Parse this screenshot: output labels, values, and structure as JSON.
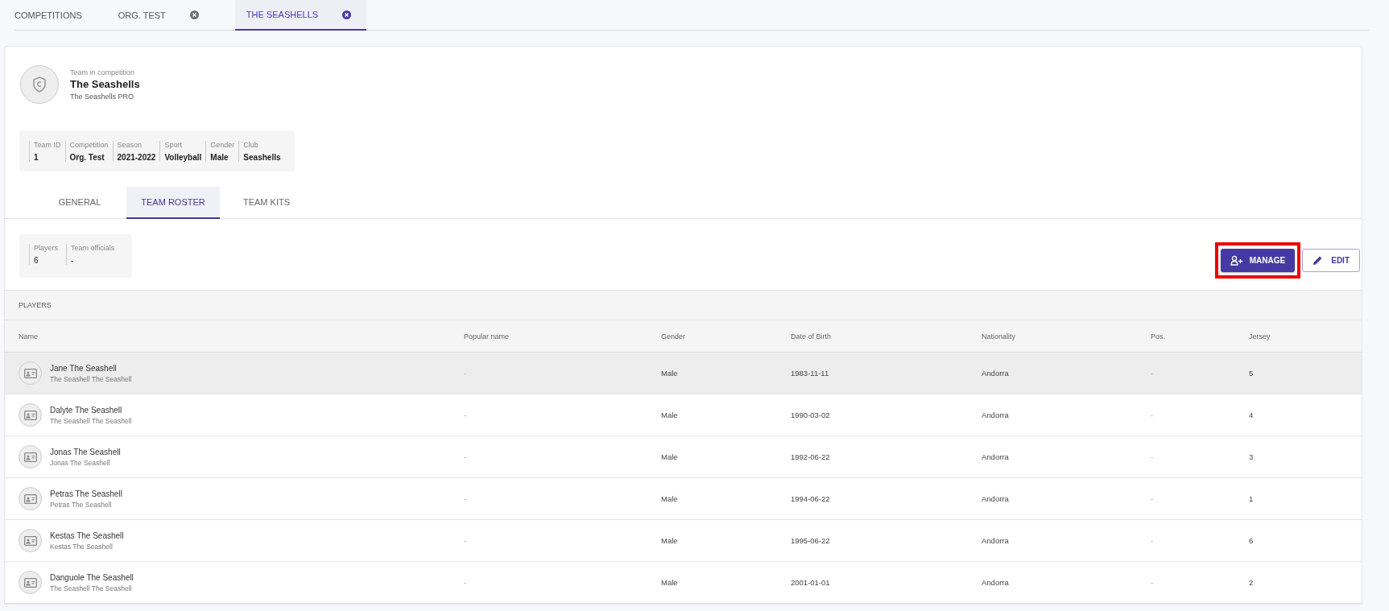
{
  "top_tabs": [
    {
      "label": "COMPETITIONS",
      "closable": false,
      "selected": false
    },
    {
      "label": "ORG. TEST",
      "closable": true,
      "selected": false
    },
    {
      "label": "THE SEASHELLS",
      "closable": true,
      "selected": true
    }
  ],
  "team": {
    "caption": "Team in competition",
    "name": "The Seashells",
    "subtitle": "The Seashells PRO"
  },
  "info": [
    {
      "label": "Team ID",
      "value": "1"
    },
    {
      "label": "Competition",
      "value": "Org. Test"
    },
    {
      "label": "Season",
      "value": "2021-2022"
    },
    {
      "label": "Sport",
      "value": "Volleyball"
    },
    {
      "label": "Gender",
      "value": "Male"
    },
    {
      "label": "Club",
      "value": "Seashells"
    }
  ],
  "tabs": [
    {
      "label": "GENERAL",
      "selected": false
    },
    {
      "label": "TEAM ROSTER",
      "selected": true
    },
    {
      "label": "TEAM KITS",
      "selected": false
    }
  ],
  "summary": [
    {
      "label": "Players",
      "value": "6"
    },
    {
      "label": "Team officials",
      "value": "-"
    }
  ],
  "actions": [
    {
      "kind": "manage",
      "label": "MANAGE",
      "highlighted": true
    },
    {
      "kind": "edit",
      "label": "EDIT",
      "highlighted": false
    }
  ],
  "table": {
    "title": "PLAYERS",
    "columns": [
      "Name",
      "Popular name",
      "Gender",
      "Date of Birth",
      "Nationality",
      "Pos.",
      "Jersey"
    ],
    "rows": [
      {
        "name": "Jane The Seashell",
        "subname": "The Seashell The Seashell",
        "popular_name": "-",
        "gender": "Male",
        "dob": "1983-11-11",
        "nationality": "Andorra",
        "pos": "-",
        "jersey": "5",
        "selected": true
      },
      {
        "name": "Dalyte The Seashell",
        "subname": "The Seashell The Seashell",
        "popular_name": "-",
        "gender": "Male",
        "dob": "1990-03-02",
        "nationality": "Andorra",
        "pos": "-",
        "jersey": "4",
        "selected": false
      },
      {
        "name": "Jonas The Seashell",
        "subname": "Jonas The Seashell",
        "popular_name": "-",
        "gender": "Male",
        "dob": "1992-06-22",
        "nationality": "Andorra",
        "pos": "-",
        "jersey": "3",
        "selected": false
      },
      {
        "name": "Petras The Seashell",
        "subname": "Petras The Seashell",
        "popular_name": "-",
        "gender": "Male",
        "dob": "1994-06-22",
        "nationality": "Andorra",
        "pos": "-",
        "jersey": "1",
        "selected": false
      },
      {
        "name": "Kestas The Seashell",
        "subname": "Kestas The Seashell",
        "popular_name": "-",
        "gender": "Male",
        "dob": "1995-06-22",
        "nationality": "Andorra",
        "pos": "-",
        "jersey": "6",
        "selected": false
      },
      {
        "name": "Danguole The Seashell",
        "subname": "The Seashell The Seashell",
        "popular_name": "-",
        "gender": "Male",
        "dob": "2001-01-01",
        "nationality": "Andorra",
        "pos": "-",
        "jersey": "2",
        "selected": false
      }
    ]
  }
}
